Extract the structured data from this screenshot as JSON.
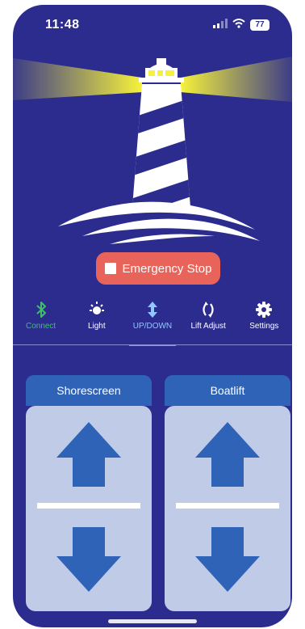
{
  "status_bar": {
    "time": "11:48",
    "battery": "77"
  },
  "emergency_stop": {
    "label": "Emergency Stop"
  },
  "tabs": [
    {
      "label": "Connect",
      "icon": "bluetooth-icon"
    },
    {
      "label": "Light",
      "icon": "sun-icon"
    },
    {
      "label": "UP/DOWN",
      "icon": "up-down-arrows-icon"
    },
    {
      "label": "Lift Adjust",
      "icon": "adjust-arrows-icon"
    },
    {
      "label": "Settings",
      "icon": "gear-icon"
    }
  ],
  "panels": [
    {
      "title": "Shorescreen"
    },
    {
      "title": "Boatlift"
    }
  ],
  "colors": {
    "background": "#2c2c8f",
    "accent_blue": "#2f63b8",
    "emergency_red": "#e8645a",
    "connect_green": "#3fbf6a",
    "light_yellow": "#f2f03c"
  }
}
